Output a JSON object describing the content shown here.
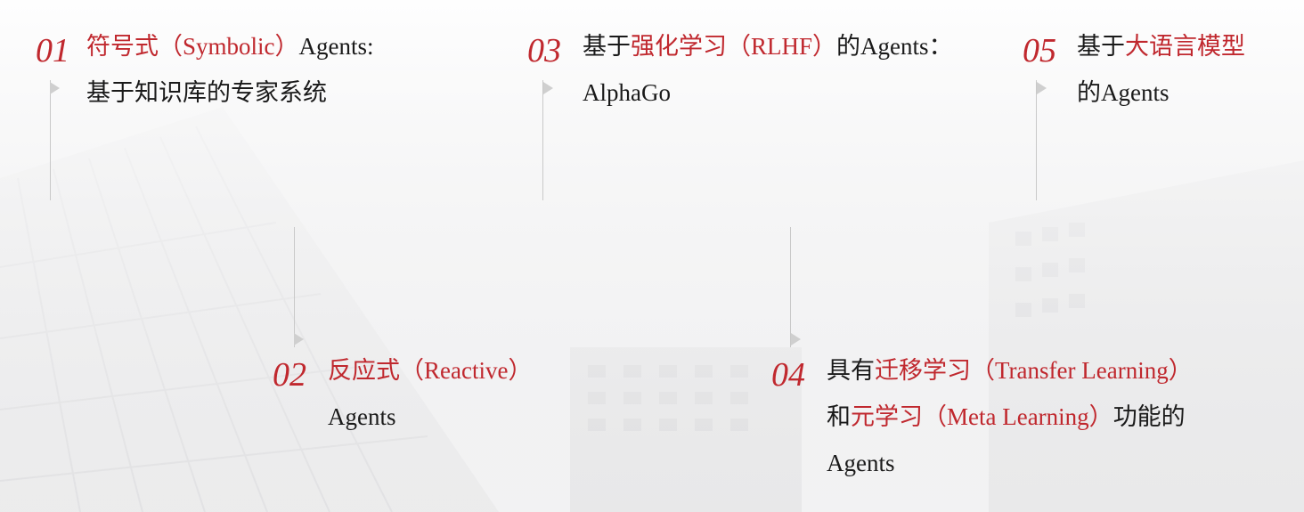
{
  "items": [
    {
      "num": "01",
      "line1": [
        {
          "t": "符号式（Symbolic）",
          "red": true
        },
        {
          "t": "Agents:",
          "red": false
        }
      ],
      "line2": [
        {
          "t": "基于知识库的专家系统",
          "red": false
        }
      ]
    },
    {
      "num": "02",
      "line1": [
        {
          "t": "反应式（Reactive）",
          "red": true
        }
      ],
      "line2": [
        {
          "t": "Agents",
          "red": false
        }
      ]
    },
    {
      "num": "03",
      "line1": [
        {
          "t": "基于",
          "red": false
        },
        {
          "t": "强化学习（RLHF）",
          "red": true
        },
        {
          "t": "的Agents：",
          "red": false
        }
      ],
      "line2": [
        {
          "t": "AlphaGo",
          "red": false
        }
      ]
    },
    {
      "num": "04",
      "line1": [
        {
          "t": "具有",
          "red": false
        },
        {
          "t": "迁移学习（Transfer Learning）",
          "red": true
        }
      ],
      "line2": [
        {
          "t": "和",
          "red": false
        },
        {
          "t": "元学习（Meta Learning）",
          "red": true
        },
        {
          "t": "功能的",
          "red": false
        }
      ],
      "line3": [
        {
          "t": "Agents",
          "red": false
        }
      ]
    },
    {
      "num": "05",
      "line1": [
        {
          "t": "基于",
          "red": false
        },
        {
          "t": "大语言模型",
          "red": true
        }
      ],
      "line2": [
        {
          "t": "的Agents",
          "red": false
        }
      ]
    }
  ],
  "colors": {
    "accent": "#c0282e",
    "text": "#1a1a1a",
    "line": "#c9c9c9",
    "arrow": "#cfcfcf"
  },
  "icons": {
    "marker": "triangle-right-icon"
  }
}
